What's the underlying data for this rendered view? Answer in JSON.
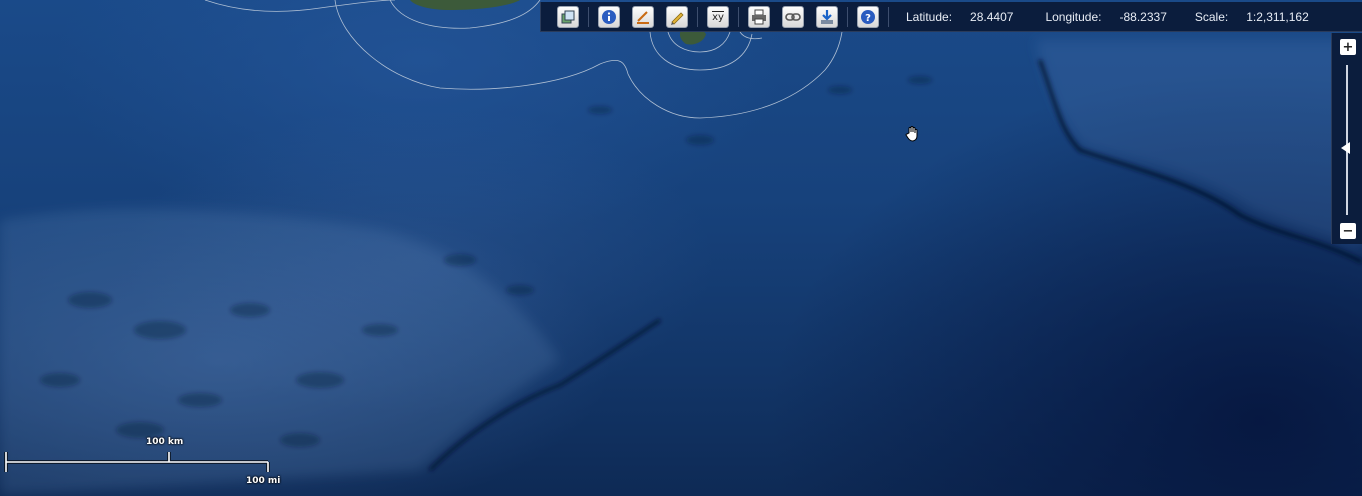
{
  "map": {
    "coastline_color": "#c8d3e0",
    "land_color": "#3c5a3a"
  },
  "toolbar": {
    "tools": [
      {
        "name": "layers-icon"
      },
      {
        "name": "info-icon"
      },
      {
        "name": "measure-icon"
      },
      {
        "name": "draw-pencil-icon"
      },
      {
        "name": "xy-coordinates-icon",
        "label": "xy"
      },
      {
        "name": "print-icon"
      },
      {
        "name": "link-icon"
      },
      {
        "name": "download-icon"
      },
      {
        "name": "help-icon"
      }
    ],
    "latitude_label": "Latitude:",
    "latitude_value": "28.4407",
    "longitude_label": "Longitude:",
    "longitude_value": "-88.2337",
    "scale_label": "Scale:",
    "scale_value": "1:2,311,162"
  },
  "zoom": {
    "plus_label": "+",
    "minus_label": "−",
    "level_fraction": 0.55
  },
  "scalebar": {
    "km_label": "100 km",
    "mi_label": "100 mi"
  },
  "cursor": {
    "icon": "pan-hand-icon"
  }
}
